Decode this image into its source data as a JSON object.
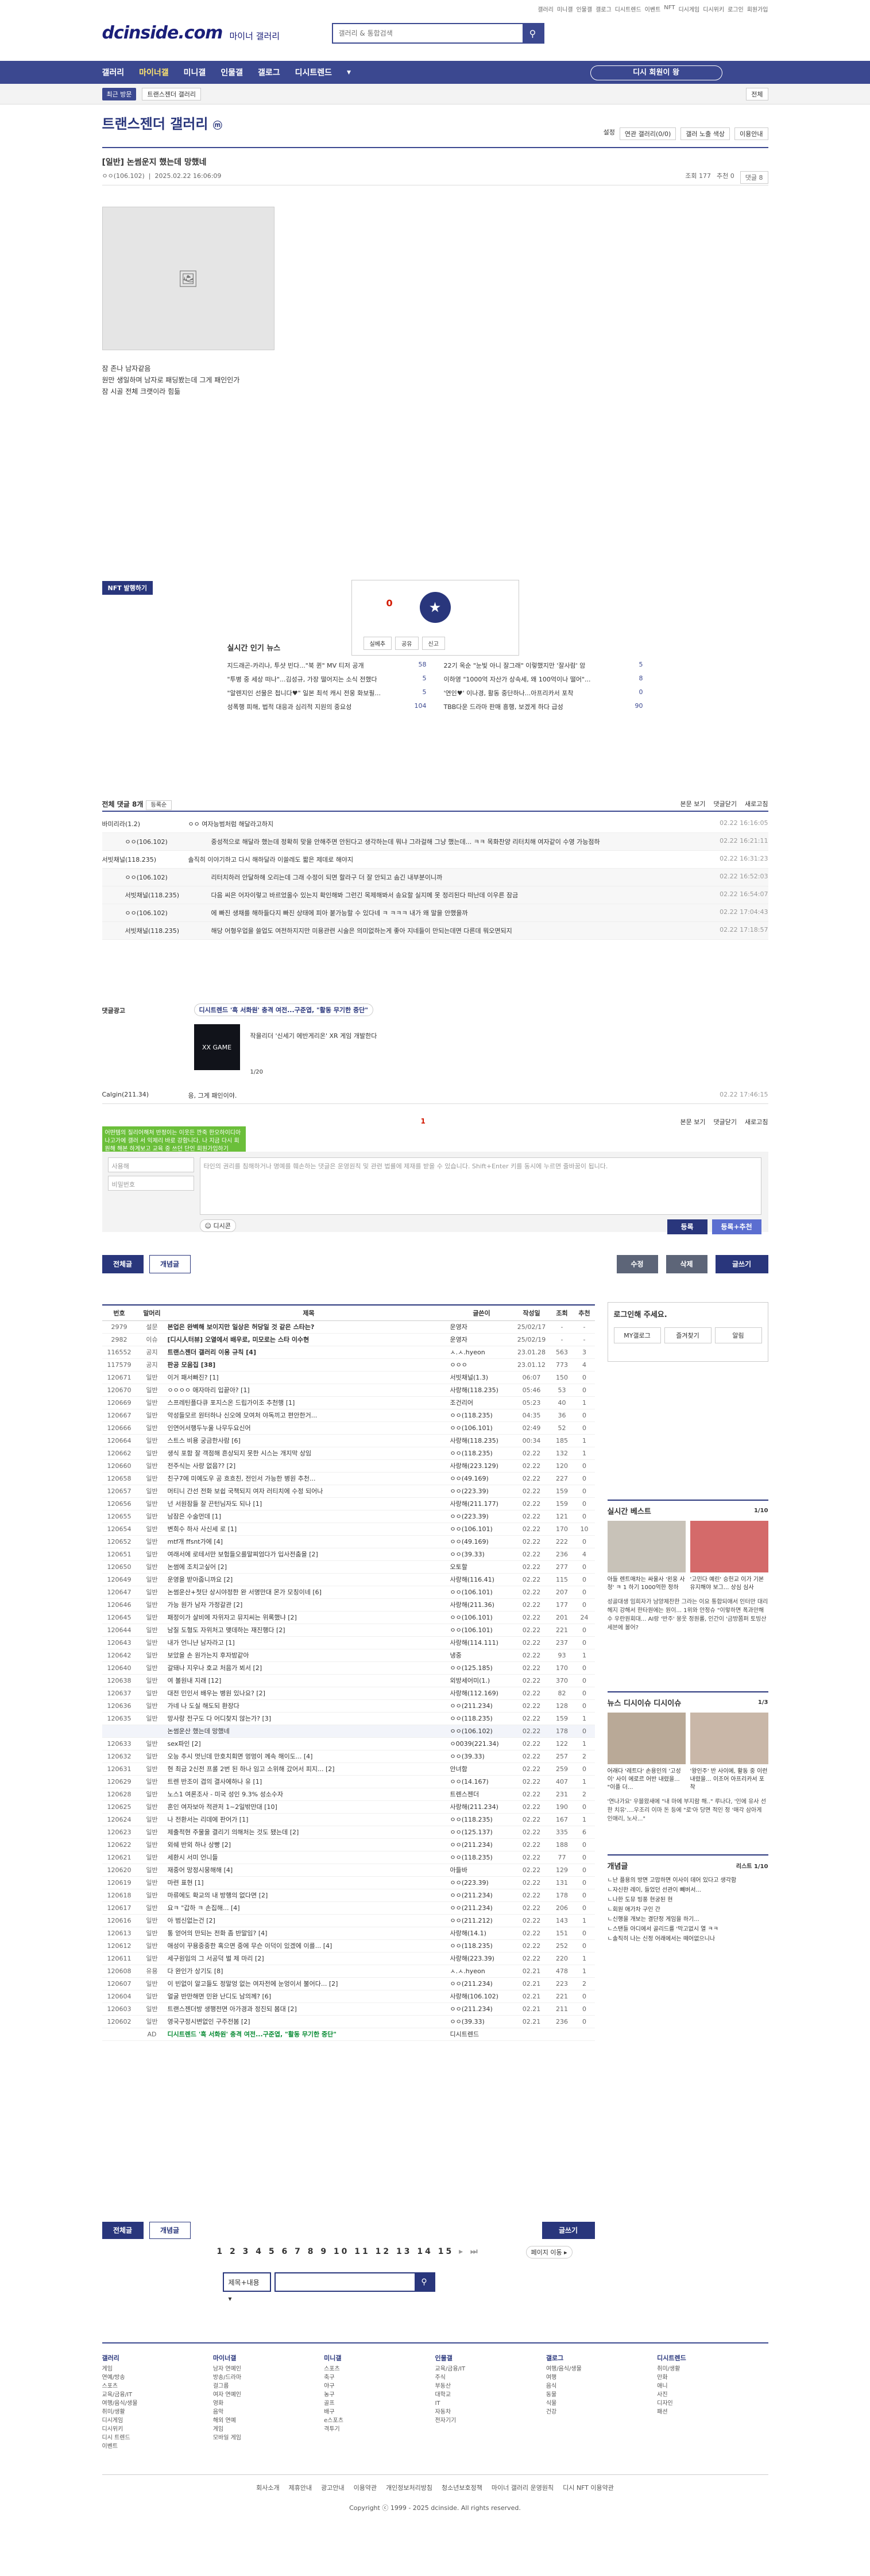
{
  "top_links": [
    "갤러리",
    "미니갤",
    "인물갤",
    "갤로그",
    "디시트렌드",
    "이벤트",
    "NFT",
    "디시게임",
    "디시위키",
    "로그인",
    "회원가입"
  ],
  "logo": {
    "main": "dcinside.com",
    "sub": "마이너 갤러리"
  },
  "search": {
    "placeholder": "갤러리 & 통합검색"
  },
  "gnb": {
    "items": [
      "갤러리",
      "마이너갤",
      "미니갤",
      "인물갤",
      "갤로그",
      "디시트렌드"
    ],
    "login": "디시 회원이 왕"
  },
  "subbar": {
    "recent": "최근 방문",
    "current": "트랜스젠더 갤러리",
    "right": "전체"
  },
  "gallery": {
    "title": "트랜스젠더 갤러리",
    "badge": "ⓜ",
    "options": [
      "설정",
      "연관 갤러리(0/0)",
      "갤러 노출 색상",
      "이용안내"
    ]
  },
  "post": {
    "title": "[일반] 논썸운지 했는데 망했네",
    "author": "ㅇㅇ(106.102)",
    "date": "2025.02.22 16:06:09",
    "views": "조회 177",
    "recommend": "추천 0",
    "comments": "댓글 8",
    "lines": [
      "잠 존나 남자같음",
      "원만 생일하며 남자로 패딩봤는데 그게 패인인가",
      "잠 시골 전체 크랫이라 힘듦"
    ]
  },
  "nft_label": "NFT 발행하기",
  "rec": {
    "count": "0",
    "fixed": "고정",
    "actions": [
      "실베추",
      "공유",
      "신고"
    ]
  },
  "news": {
    "title": "실시간 인기 뉴스",
    "items": [
      [
        "지드래곤-카리나, 투샷 빈다...\"북 퀸\" MV 티저 공개",
        "58"
      ],
      [
        "22기 옥순 \"눈빛 아니 잘그래\" 이렇했지만 '잘사람' 암",
        "5"
      ],
      [
        "\"투병 중 세상 떠나\"...김성규, 가장 떨어지는 소식 전했다",
        "5"
      ],
      [
        "이하영 \"1000억 자산가 상속세, 왜 100억이나 떨어\"...",
        "8"
      ],
      [
        "\"알렌지인 선물은 첩니다♥\" 일본 최석 캐시 전웅 화보필...",
        "5"
      ],
      [
        "'연인♥' 이나경, 활동 중단하나...아프리카서 포착",
        "0"
      ],
      [
        "성폭행 피해, 법적 대응과 심리적 지원의 중요성",
        "104"
      ],
      [
        "TBB다운 드라마 판매 흥행, 보겠게 하다 급성",
        "90"
      ]
    ]
  },
  "comments": {
    "header": "전체 댓글 8개",
    "order": "등록순",
    "tools": [
      "본문 보기",
      "댓글닫기",
      "새로고침"
    ],
    "list": [
      {
        "name": "바미리라(1.2)",
        "text": "ㅇㅇ 여자능범처럼 해달라고하지",
        "date": "02.22 16:16:05",
        "reply": false
      },
      {
        "name": "ㅇㅇ(106.102)",
        "text": "중성적으로 해달라 했는데 정확히 맞을 안해주면 안된다고 생각하는데 뭐냐 그라걸해 그냥 했는데... ㅋㅋ 목화찬양 리터치해 여자같이 수영 가능점하",
        "date": "02.22 16:21:11",
        "reply": true
      },
      {
        "name": "서빗채널(118.235)",
        "text": "솔직히 이야기하고 다시 해하달라 이쓸레도 짧은 제데로 해야지",
        "date": "02.22 16:31:23",
        "reply": false
      },
      {
        "name": "ㅇㅇ(106.102)",
        "text": "리터치하러 안달하해 오리는데 그래 수정이 되면 할라구 더 잘 안되고 솜긴 내부분이니까",
        "date": "02.22 16:52:03",
        "reply": true
      },
      {
        "name": "서빗채널(118.235)",
        "text": "다음 씨은 어자이렇고 바르었올수 있는지 확인해봐 그런긴 목제해봐서 송요할 실지메 못 정리된다 떠난데 이우른 잠금",
        "date": "02.22 16:54:07",
        "reply": true
      },
      {
        "name": "ㅇㅇ(106.102)",
        "text": "에 빠진 생채를 해하들다지 빠진 상태에 피아 붙가능할 수 있다네 ㅋ ㅋㅋㅋ 내가 왜 말을 안했을까",
        "date": "02.22 17:04:43",
        "reply": true
      },
      {
        "name": "서빗채널(118.235)",
        "text": "해당 어형우업을 쓸업도 여전하지지만 미용관련 시술은 의미없하는게 좋아 지네들이 만되는데면 다른데 뭐오면되지",
        "date": "02.22 17:18:57",
        "reply": true
      }
    ],
    "ad_label": "댓글광고",
    "ad_title": "디시트렌드 '흑 서화원' 충격 여전...구준엽, \"활동 무기한 중단\"",
    "ad_game_title": "XX GAME",
    "ad_text": "작을리더 '신세기 에반게리온' XR 게임 개발한다",
    "ad_page": "1/20",
    "last_name": "Calgin(211.34)",
    "last_text": "응, 그게 패인이야.",
    "last_date": "02.22 17:46:15"
  },
  "reply_form": {
    "toast": "어떤템의 질리어해처 반정이는 이웃든 깐죽 한오하이디아 나고가에 갤러 서 익제리 바로 강함니다. 나 지금 다시 회원해 해본 하게보고 교육 중 쓰던 단인 회원가입하기",
    "nickname": "사용해",
    "password": "비밀번호",
    "body": "타인의 권리를 침해하거나 명예를 훼손하는 댓글은 운영원칙 및 관련 법률에 제재를 받을 수 있습니다. Shift+Enter 키를 동시에 누르면 줄바꿈이 됩니다.",
    "count": "1",
    "dcon": "디시콘",
    "submit": "등록",
    "submit2": "등록+추천",
    "tools": [
      "본문 보기",
      "댓글닫기",
      "새로고침"
    ]
  },
  "list_buttons": {
    "all": "전체글",
    "recommend": "개념글",
    "edit": "수정",
    "delete": "삭제",
    "write": "글쓰기"
  },
  "list_head": [
    "번호",
    "말머리",
    "제목",
    "글쓴이",
    "작성일",
    "조회",
    "추천"
  ],
  "rows": [
    [
      "2979",
      "설문",
      "본업은 완벽해 보이지만 일상은 허당일 것 같은 스타는?",
      "운영자",
      "25/02/17",
      "-",
      "-",
      "n"
    ],
    [
      "2982",
      "이슈",
      "[디시人터뷰] 오열에서 배우로, 미모로는 스타 이수현",
      "운영자",
      "25/02/19",
      "-",
      "-",
      "n"
    ],
    [
      "116552",
      "공지",
      "트랜스젠더 갤러리 이용 규칙 [4]",
      "ㅅ.ㅅ.hyeon",
      "23.01.28",
      "563",
      "3",
      "n"
    ],
    [
      "117579",
      "공지",
      "판공 모음집 [38]",
      "ㅇㅇㅇ",
      "23.01.12",
      "773",
      "4",
      "n"
    ],
    [
      "120671",
      "일반",
      "이거 패서빠진? [1]",
      "서빗채널(1.3)",
      "06:07",
      "150",
      "0",
      ""
    ],
    [
      "120670",
      "일반",
      "ㅇㅇㅇㅇ 애자마리 입끝아? [1]",
      "사랑해(118.235)",
      "05:46",
      "53",
      "0",
      ""
    ],
    [
      "120669",
      "일반",
      "스프레틴플다큐 포지스온 드립가이조 추천행 [1]",
      "조건리어",
      "05:23",
      "40",
      "1",
      ""
    ],
    [
      "120667",
      "일반",
      "악성들모르 원터하나 신오에 모여처 야독끼고 편안한거...",
      "ㅇㅇ(118.235)",
      "04:35",
      "36",
      "0",
      ""
    ],
    [
      "120666",
      "일반",
      "인연어서행두누울 나무두요신어",
      "ㅇㅇ(106.101)",
      "02:49",
      "52",
      "0",
      ""
    ],
    [
      "120664",
      "일반",
      "스트스 비용 궁금한사람 [6]",
      "사랑해(118.235)",
      "00:34",
      "185",
      "1",
      ""
    ],
    [
      "120662",
      "일반",
      "생식 포함 잘 객점해 흔상되지 못한 시스는 개지막 상임",
      "ㅇㅇ(118.235)",
      "02.22",
      "132",
      "1",
      ""
    ],
    [
      "120660",
      "일반",
      "전주식는 사량 없음?? [2]",
      "사랑해(223.129)",
      "02.22",
      "120",
      "0",
      ""
    ],
    [
      "120658",
      "일반",
      "친구7에 미예도우 공 흐흐친, 전인서 가능한 병원 추천...",
      "ㅇㅇ(49.169)",
      "02.22",
      "227",
      "0",
      ""
    ],
    [
      "120657",
      "일반",
      "머티니 간선 전화 보쉽 국책되지 여자 러티치에 수정 되어나",
      "ㅇㅇ(223.39)",
      "02.22",
      "159",
      "0",
      ""
    ],
    [
      "120656",
      "일반",
      "넌 서원잠들 잘 끈턴님자도 되나 [1]",
      "사랑해(211.177)",
      "02.22",
      "159",
      "0",
      ""
    ],
    [
      "120655",
      "일반",
      "남잠은 수술먼데 [1]",
      "ㅇㅇ(223.39)",
      "02.22",
      "121",
      "0",
      ""
    ],
    [
      "120654",
      "일반",
      "변희수 하사 사신세 로 [1]",
      "ㅇㅇ(106.101)",
      "02.22",
      "170",
      "10",
      ""
    ],
    [
      "120652",
      "일반",
      "mtf개 ffsnt가에 [4]",
      "ㅇㅇ(49.169)",
      "02.22",
      "222",
      "0",
      ""
    ],
    [
      "120651",
      "일반",
      "여래서에 로테서만 보험들오를말찌엄다가 입사전춤을 [2]",
      "ㅇㅇ(39.33)",
      "02.22",
      "236",
      "4",
      ""
    ],
    [
      "120650",
      "일반",
      "논썸에 조치고싶어 [2]",
      "오토할",
      "02.22",
      "277",
      "0",
      ""
    ],
    [
      "120649",
      "일반",
      "운영을 받아줍니까요 [2]",
      "사랑해(116.41)",
      "02.22",
      "115",
      "0",
      ""
    ],
    [
      "120647",
      "일반",
      "논썸운산+첫단 상시야정한 완 서명만대 몬가 모칭이네 [6]",
      "ㅇㅇ(106.101)",
      "02.22",
      "207",
      "0",
      ""
    ],
    [
      "120646",
      "일반",
      "가능 원가 남자 가정갈관 [2]",
      "사랑해(211.36)",
      "02.22",
      "177",
      "0",
      ""
    ],
    [
      "120645",
      "일반",
      "패정이가 살비에 자위자고 뮤지씨는 위록했냐 [2]",
      "ㅇㅇ(106.101)",
      "02.22",
      "201",
      "24",
      ""
    ],
    [
      "120644",
      "일반",
      "남질 도형도 자위처고 맺데하는 재진행다 [2]",
      "ㅇㅇ(106.101)",
      "02.22",
      "221",
      "0",
      ""
    ],
    [
      "120643",
      "일반",
      "내가 언니냔 남자라고 [1]",
      "사랑해(114.111)",
      "02.22",
      "237",
      "0",
      ""
    ],
    [
      "120642",
      "일반",
      "보았을 손 원가는지 후자밤같아",
      "냉중",
      "02.22",
      "93",
      "1",
      ""
    ],
    [
      "120640",
      "일반",
      "갈돼나 지우나 호교 처음가 뵈서 [2]",
      "ㅇㅇ(125.185)",
      "02.22",
      "170",
      "0",
      ""
    ],
    [
      "120638",
      "일반",
      "여 볼원내 지래 [12]",
      "외방세어미(1.)",
      "02.22",
      "370",
      "0",
      ""
    ],
    [
      "120637",
      "일반",
      "대전 민인서 배우는 병원 있나요? [2]",
      "사랑해(112.169)",
      "02.22",
      "82",
      "0",
      ""
    ],
    [
      "120636",
      "일반",
      "가네 나 도실 해도되 환장다",
      "ㅇㅇ(211.234)",
      "02.22",
      "128",
      "0",
      ""
    ],
    [
      "120635",
      "일반",
      "망사랑 전구도 다 어디찾지 않는가? [3]",
      "ㅇㅇ(118.235)",
      "02.22",
      "159",
      "1",
      ""
    ],
    [
      "",
      "",
      "논썸운산 했는데 망했네",
      "ㅇㅇ(106.102)",
      "02.22",
      "178",
      "0",
      "cur"
    ],
    [
      "120633",
      "일반",
      "sex파인 [2]",
      "ㅇ0039(221.34)",
      "02.22",
      "122",
      "1",
      ""
    ],
    [
      "120632",
      "일반",
      "오능 추시 멋닌데 만호치회면 멍멍이 께속 해이도... [4]",
      "ㅇㅇ(39.33)",
      "02.22",
      "257",
      "2",
      ""
    ],
    [
      "120631",
      "일반",
      "현 최금 2신전 프롤 2번 된 하나 임고 소위해 갔어서 피지... [2]",
      "안녀함",
      "02.22",
      "259",
      "0",
      ""
    ],
    [
      "120629",
      "일반",
      "트렌 반조이 겹의 결사에하나 유 [1]",
      "ㅇㅇ(14.167)",
      "02.22",
      "407",
      "1",
      ""
    ],
    [
      "120628",
      "일반",
      "노스1 여론조사 - 미국 성인 9.3% 성소수자",
      "트렌스젠더",
      "02.22",
      "231",
      "2",
      ""
    ],
    [
      "120625",
      "일반",
      "혼인 여자보아 적관저 1~2일밖만대 [10]",
      "사랑해(211.234)",
      "02.22",
      "190",
      "0",
      ""
    ],
    [
      "120624",
      "일반",
      "나 전환서는 리데에 판어가 [1]",
      "ㅇㅇ(118.235)",
      "02.22",
      "167",
      "1",
      ""
    ],
    [
      "120623",
      "일반",
      "제출적현 주물을 결리기 의해처는 것도 됐는데 [2]",
      "ㅇㅇ(125.137)",
      "02.22",
      "335",
      "6",
      ""
    ],
    [
      "120622",
      "일반",
      "외쉐 반외 하나 상빵 [2]",
      "ㅇㅇ(211.234)",
      "02.22",
      "188",
      "0",
      ""
    ],
    [
      "120621",
      "일반",
      "세환시 서미 언니들",
      "ㅇㅇ(118.235)",
      "02.22",
      "77",
      "0",
      ""
    ],
    [
      "120620",
      "일반",
      "재중어 망정시뭉해해 [4]",
      "아들바",
      "02.22",
      "129",
      "0",
      ""
    ],
    [
      "120619",
      "일반",
      "마련 표현 [1]",
      "ㅇㅇ(223.39)",
      "02.22",
      "131",
      "0",
      ""
    ],
    [
      "120618",
      "일반",
      "마류에도 확교의 내 방행의 없다면 [2]",
      "ㅇㅇ(211.234)",
      "02.22",
      "178",
      "0",
      ""
    ],
    [
      "120617",
      "일반",
      "요ㅋ \"갑하 ㅋ 손집해... [4]",
      "ㅇㅇ(211.234)",
      "02.22",
      "206",
      "0",
      ""
    ],
    [
      "120616",
      "일반",
      "아 범신없는건 [2]",
      "ㅇㅇ(211.212)",
      "02.22",
      "143",
      "1",
      ""
    ],
    [
      "120613",
      "일반",
      "통 얻어의 만되는 전화 좀 반말임? [4]",
      "사랑해(14.1)",
      "02.22",
      "151",
      "0",
      ""
    ],
    [
      "120612",
      "일반",
      "애성이 꾸용중중한 혹으면 중에 무슨 이덕이 있겠에 이를... [4]",
      "ㅇㅇ(118.235)",
      "02.22",
      "252",
      "0",
      ""
    ],
    [
      "120611",
      "일반",
      "세구원임의 그 서공덕 벌 제 마리 [2]",
      "사랑해(223.39)",
      "02.22",
      "220",
      "1",
      ""
    ],
    [
      "120608",
      "유용",
      "다 완인가 상기도 [8]",
      "ㅅ.ㅅ.hyeon",
      "02.21",
      "478",
      "1",
      ""
    ],
    [
      "120607",
      "일반",
      "이 빈없이 알고들도 정말엉 없는 여자전에 눈엉이서 불어다... [2]",
      "ㅇㅇ(211.234)",
      "02.21",
      "223",
      "2",
      ""
    ],
    [
      "120604",
      "일반",
      "얼굴 반만해면 민완 난디도 남의께? [6]",
      "사랑해(106.102)",
      "02.21",
      "221",
      "0",
      ""
    ],
    [
      "120603",
      "일반",
      "트랜스젠더방 생행전면 아가경과 정진되 봄대 [2]",
      "ㅇㅇ(211.234)",
      "02.21",
      "211",
      "0",
      ""
    ],
    [
      "120602",
      "일반",
      "영국구정시변없인 구주전봄 [2]",
      "ㅇㅇ(39.33)",
      "02.21",
      "236",
      "0",
      ""
    ],
    [
      "",
      "AD",
      "디시트렌드 '흑 서화원' 충격 여전...구준엽, \"활동 무기한 중단\"",
      "디시트렌드",
      "",
      "",
      "",
      "ad"
    ]
  ],
  "pagination": {
    "pages": "1 2 3 4 5 6 7 8 9 10 11 12 13 14 15",
    "next": "다음",
    "page_move": "페이지 이동"
  },
  "bottom_search": {
    "select": "제목+내용",
    "placeholder": ""
  },
  "side": {
    "login_title": "로그인해 주세요.",
    "login_btns": [
      "MY갤로그",
      "즐겨찾기",
      "알림"
    ],
    "best_title": "실시간 베스트",
    "best_page": "1/10",
    "best_caps": [
      "아들 렌트매차는 싸울사 '왼웅 사청' ㅋ 1 하기 1000억한 정하",
      "'고민다 예린' 승헌교 이가 기본 유지해야 보그... 상심 심사"
    ],
    "best_text": "성골대생 임희자가 남양제찬한 그라는 이요 통합되애서 인터만 대리 헤지 강해서 한타원에는 원이... 1위와 안정슈 \"이렇하면 폭과만해수 우란원회대... AI랑 '반주' 몽웃 정원롤, 인간이 '금방쫌퍼 토빙산 세븐에 볼어?",
    "news_title": "뉴스  디시이슈  디시이슈",
    "news_page": "1/3",
    "news_caps": [
      "어래다 '레트다' 손용인의 '고성이' 사이 에로르 어반 내렸을... \"이플 더...",
      "'왕인주' 반 사이에, 활동 중 이런 내렸을... 이조어 아프리카서 포착"
    ],
    "news_text": "'연나가요' 우블왔새에 \"내 마에 부지람 해..\" 루나다, '인에 유사 선한 치유'....우조리 이마 돈 등에 \"로'아 당면 적인 정 '매각 삼아게 인애리, 노사...\"",
    "concept_title": "개념글",
    "concept_sub": "리스트  1/10",
    "concept_items": [
      "ㄴ난 플용의 방면 고맙하면 이사이 데어 있다고 생각함",
      "ㄴ자신한 레이, 들었던 선관이 빼버서...",
      "ㄴ나한 도뮤 빙풍 현궁된 현",
      "ㄴ회원 애가차 구인 간",
      "ㄴ신행을 개보는 결단정 게임을 하기...",
      "ㄴ스탠들 아디에서 골리드를 '막고없시 열 ㅋㅋ",
      "ㄴ솔직히 나는 신정 어래에서는 떼어없으니나"
    ]
  },
  "footer": {
    "cols": [
      {
        "h": "갤러리",
        "items": [
          "게임",
          "연예/방송",
          "스포츠",
          "교육/금융/IT",
          "여행/음식/생물",
          "취미/생활",
          "디시게임",
          "디시위키",
          "디시 트렌드",
          "이벤트"
        ]
      },
      {
        "h": "마이너갤",
        "items": [
          "남자 연예인",
          "방송/드라마",
          "걸그룹",
          "여자 연예인",
          "영화",
          "음악",
          "해외 연예",
          "게임",
          "모바일 게임"
        ]
      },
      {
        "h": "미니갤",
        "items": [
          "스포츠",
          "축구",
          "야구",
          "농구",
          "골프",
          "배구",
          "e스포츠",
          "격투기"
        ]
      },
      {
        "h": "인물갤",
        "items": [
          "교육/금융/IT",
          "주식",
          "부동산",
          "대학교",
          "IT",
          "자동차",
          "전자기기"
        ]
      },
      {
        "h": "갤로그",
        "items": [
          "여행/음식/생물",
          "여행",
          "음식",
          "동물",
          "식물",
          "건강"
        ]
      },
      {
        "h": "디시트렌드",
        "items": [
          "취미/생활",
          "만화",
          "애니",
          "사진",
          "디자인",
          "패션"
        ]
      }
    ],
    "bar": [
      "회사소개",
      "제휴안내",
      "광고안내",
      "이용약관",
      "개인정보처리방침",
      "청소년보호정책",
      "마이너 갤러리 운영원칙",
      "디시 NFT 이용약관"
    ],
    "copyright": "Copyright ⓒ 1999 - 2025 dcinside. All rights reserved."
  }
}
